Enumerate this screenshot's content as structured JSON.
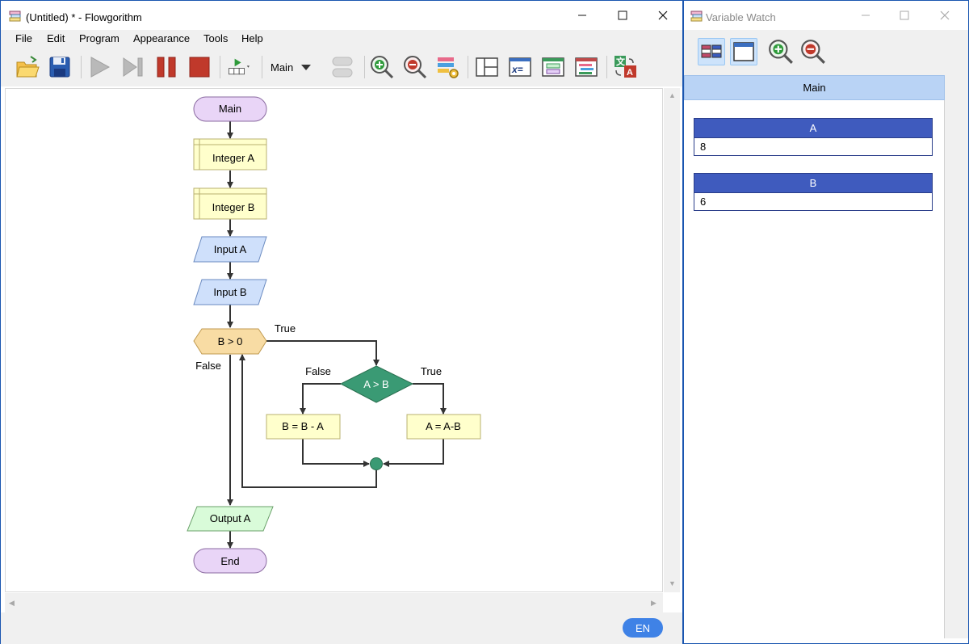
{
  "main_window": {
    "title": "(Untitled) * - Flowgorithm",
    "menu": [
      "File",
      "Edit",
      "Program",
      "Appearance",
      "Tools",
      "Help"
    ],
    "toolbar": {
      "function_select": "Main",
      "icons": [
        "open-folder-icon",
        "save-icon",
        "run-icon",
        "step-icon",
        "pause-icon",
        "stop-icon",
        "run-speed-icon",
        "zoom-in-icon",
        "zoom-out-icon",
        "layout-icon",
        "variable-watch-icon",
        "console-icon",
        "chart-icon",
        "table-icon",
        "translate-icon"
      ]
    },
    "language_button": "EN"
  },
  "flowchart": {
    "start": "Main",
    "declare_a": "Integer A",
    "declare_b": "Integer B",
    "input_a": "Input A",
    "input_b": "Input B",
    "loop_condition": "B > 0",
    "loop_true": "True",
    "loop_false": "False",
    "if_condition": "A > B",
    "if_false": "False",
    "if_true": "True",
    "assign_false": "B = B - A",
    "assign_true": "A = A-B",
    "output": "Output A",
    "end": "End",
    "colors": {
      "terminal": "#e9d5f7",
      "declare": "#ffffcc",
      "input": "#cfe0fb",
      "loop": "#f8dca4",
      "decision": "#3a9a74",
      "output": "#d9fbd9"
    }
  },
  "watch_window": {
    "title": "Variable Watch",
    "scope": "Main",
    "variables": [
      {
        "name": "A",
        "value": "8"
      },
      {
        "name": "B",
        "value": "6"
      }
    ]
  }
}
